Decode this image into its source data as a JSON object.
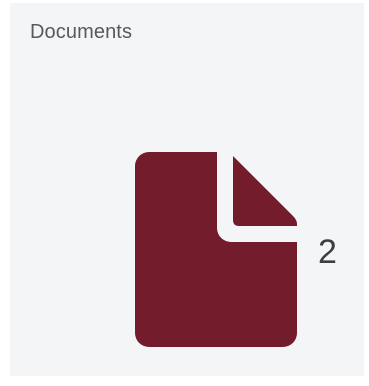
{
  "tile": {
    "title": "Documents",
    "count": "2",
    "icon": "document-icon",
    "icon_color": "#731c2c",
    "background": "#f4f5f7"
  }
}
